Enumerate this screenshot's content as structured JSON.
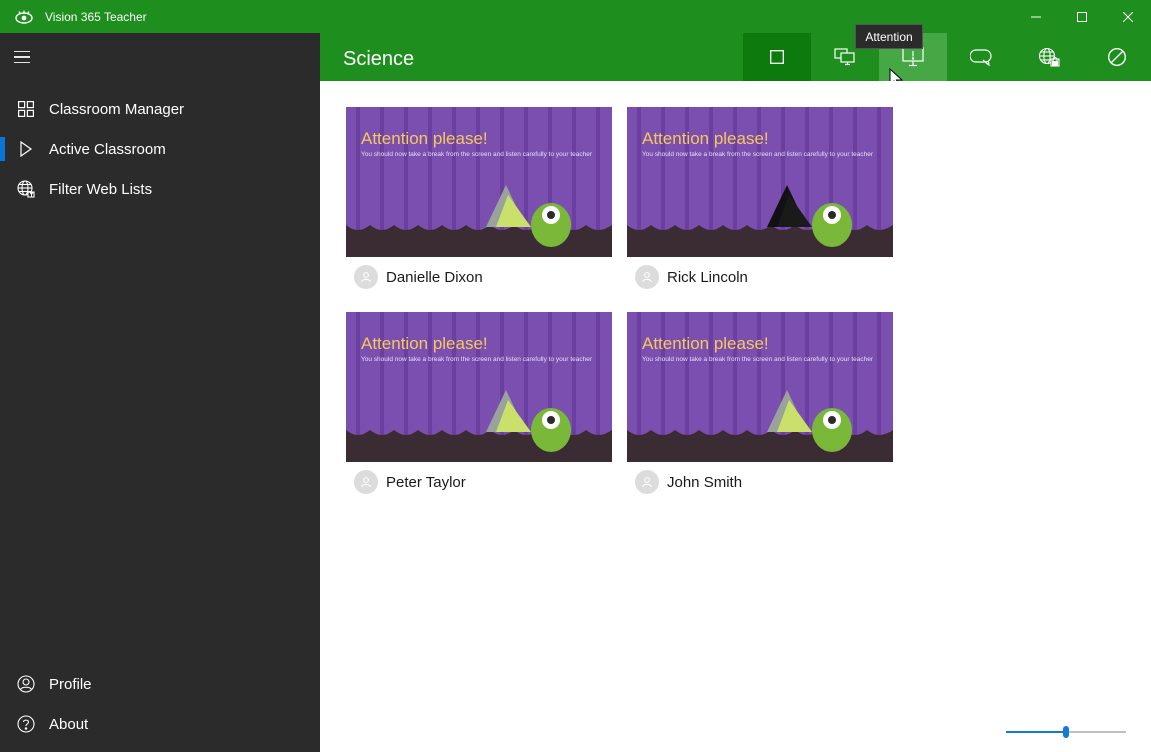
{
  "window": {
    "title": "Vision 365 Teacher"
  },
  "sidebar": {
    "items": [
      {
        "label": "Classroom Manager",
        "icon": "grid-icon"
      },
      {
        "label": "Active Classroom",
        "icon": "play-icon",
        "active": true
      },
      {
        "label": "Filter Web Lists",
        "icon": "globe-filter-icon"
      }
    ],
    "bottom_items": [
      {
        "label": "Profile",
        "icon": "person-icon"
      },
      {
        "label": "About",
        "icon": "help-icon"
      }
    ]
  },
  "header": {
    "class_name": "Science",
    "tooltip": "Attention",
    "tools": [
      "thumbnails-icon",
      "share-screen-icon",
      "attention-icon",
      "chat-icon",
      "web-lock-icon",
      "block-icon"
    ]
  },
  "slide": {
    "title": "Attention please!",
    "subtitle": "You should now take a break from the screen and listen carefully to your teacher"
  },
  "students": [
    {
      "name": "Danielle Dixon"
    },
    {
      "name": "Rick Lincoln"
    },
    {
      "name": "Peter Taylor"
    },
    {
      "name": "John Smith"
    }
  ],
  "zoom": {
    "value": 0.5
  },
  "colors": {
    "accent_green": "#1e8e1e",
    "sidebar_bg": "#2b2b2b",
    "active_indicator": "#0a74d8",
    "slide_purple": "#7b4fb0"
  }
}
